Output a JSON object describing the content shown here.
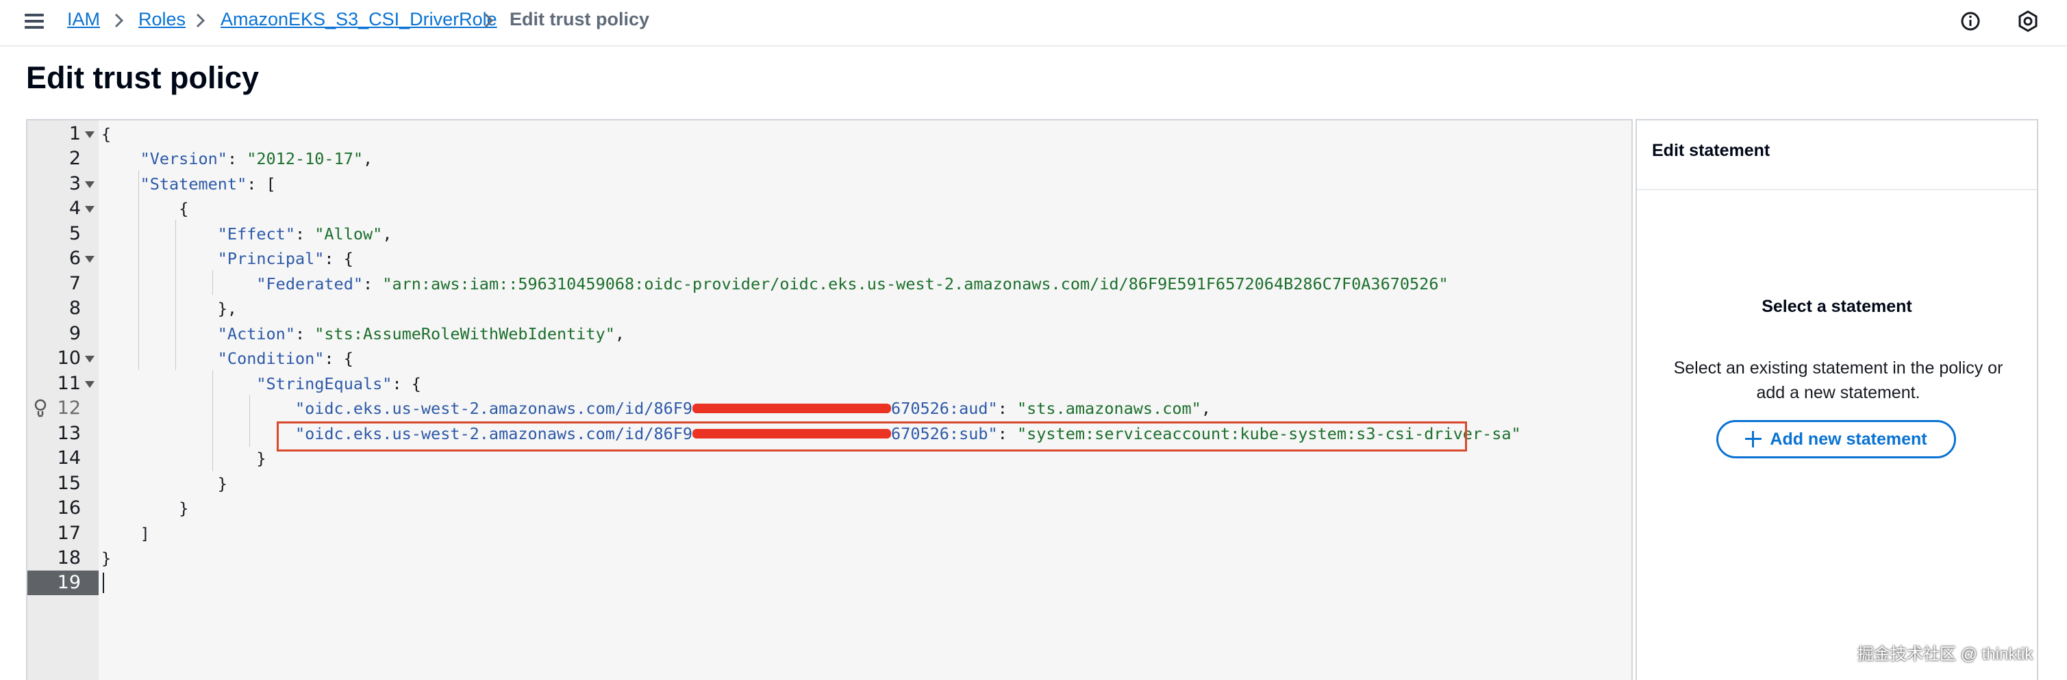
{
  "header": {
    "breadcrumbs": [
      {
        "label": "IAM"
      },
      {
        "label": "Roles"
      },
      {
        "label": "AmazonEKS_S3_CSI_DriverRole"
      }
    ],
    "current": "Edit trust policy",
    "icons": [
      "menu-icon",
      "info-icon",
      "settings-icon"
    ]
  },
  "page": {
    "title": "Edit trust policy"
  },
  "editor": {
    "line_numbers": [
      "1",
      "2",
      "3",
      "4",
      "5",
      "6",
      "7",
      "8",
      "9",
      "10",
      "11",
      "12",
      "13",
      "14",
      "15",
      "16",
      "17",
      "18",
      "19"
    ],
    "active_line": "19",
    "code": {
      "l1": "{",
      "l2_key": "\"Version\"",
      "l2_val": "\"2012-10-17\"",
      "l3_key": "\"Statement\"",
      "l3_rest": ": [",
      "l4": "{",
      "l5_key": "\"Effect\"",
      "l5_val": "\"Allow\"",
      "l6_key": "\"Principal\"",
      "l6_rest": ": {",
      "l7_key": "\"Federated\"",
      "l7_val": "\"arn:aws:iam::596310459068:oidc-provider/oidc.eks.us-west-2.amazonaws.com/id/86F9E591F6572064B286C7F0A3670526\"",
      "l8": "},",
      "l9_key": "\"Action\"",
      "l9_val": "\"sts:AssumeRoleWithWebIdentity\"",
      "l10_key": "\"Condition\"",
      "l10_rest": ": {",
      "l11_key": "\"StringEquals\"",
      "l11_rest": ": {",
      "l12_key_a": "\"oidc.eks.us-west-2.amazonaws.com/id/86F9",
      "l12_key_b": "670526:aud\"",
      "l12_val": "\"sts.amazonaws.com\"",
      "l13_key_a": "\"oidc.eks.us-west-2.amazonaws.com/id/86F9",
      "l13_key_b": "670526:sub\"",
      "l13_val": "\"system:serviceaccount:kube-system:s3-csi-driver-sa\"",
      "l14": "}",
      "l15": "}",
      "l16": "}",
      "l17": "]",
      "l18": "}"
    }
  },
  "side_panel": {
    "title": "Edit statement",
    "empty_title": "Select a statement",
    "empty_desc": "Select an existing statement in the policy or add a new statement.",
    "add_button": "Add new statement"
  },
  "watermark": "掘金技术社区 @ thinktik",
  "colors": {
    "link": "#0972d3",
    "highlight": "#d9482b",
    "redaction": "#ea3323",
    "string": "#1c6f2c",
    "key": "#2d59a8"
  }
}
